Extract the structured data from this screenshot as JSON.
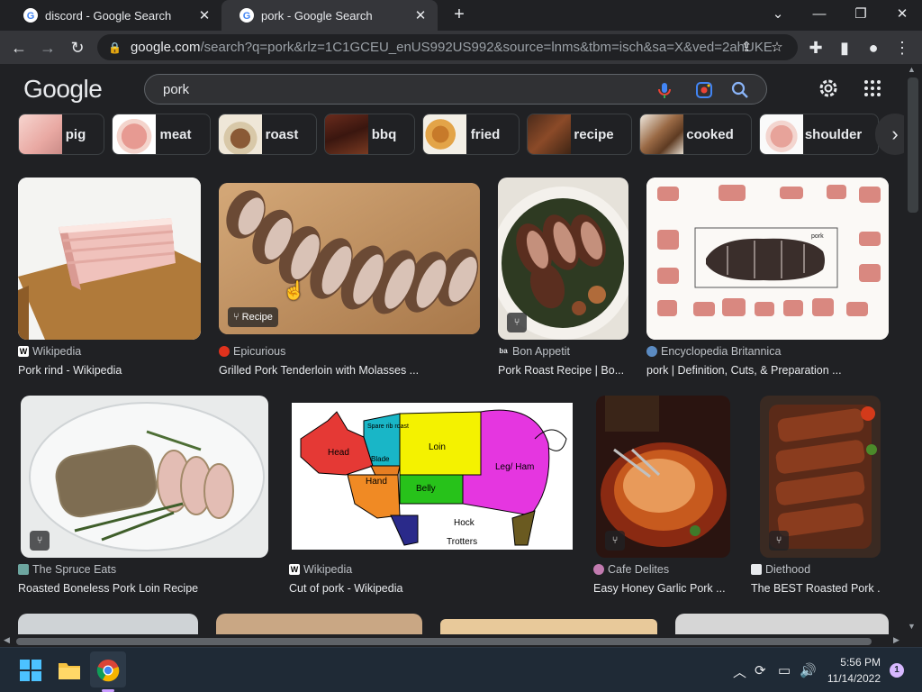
{
  "tabs": [
    {
      "title": "discord - Google Search",
      "active": false
    },
    {
      "title": "pork - Google Search",
      "active": true
    }
  ],
  "toolbar": {
    "url_host": "google.com",
    "url_path": "/search?q=pork&rlz=1C1GCEU_enUS992US992&source=lnms&tbm=isch&sa=X&ved=2ahUKE..."
  },
  "google": {
    "logo": "Google",
    "query": "pork"
  },
  "chips": [
    "pig",
    "meat",
    "roast",
    "bbq",
    "fried",
    "recipe",
    "cooked",
    "shoulder"
  ],
  "results_row1": [
    {
      "source": "Wikipedia",
      "title": "Pork rind - Wikipedia"
    },
    {
      "source": "Epicurious",
      "title": "Grilled Pork Tenderloin with Molasses ...",
      "badge": "Recipe"
    },
    {
      "source": "Bon Appetit",
      "title": "Pork Roast Recipe | Bo..."
    },
    {
      "source": "Encyclopedia Britannica",
      "title": "pork | Definition, Cuts, & Preparation ..."
    }
  ],
  "results_row2": [
    {
      "source": "The Spruce Eats",
      "title": "Roasted Boneless Pork Loin Recipe"
    },
    {
      "source": "Wikipedia",
      "title": "Cut of pork - Wikipedia"
    },
    {
      "source": "Cafe Delites",
      "title": "Easy Honey Garlic Pork ..."
    },
    {
      "source": "Diethood",
      "title": "The BEST Roasted Pork ..."
    }
  ],
  "pig_diagram": {
    "labels": [
      "Head",
      "Spare rib roast",
      "Blade",
      "Loin",
      "Hand",
      "Belly",
      "Leg/ Ham",
      "Hock",
      "Trotters"
    ]
  },
  "britannica_diagram": {
    "labels": [
      "pork"
    ]
  },
  "taskbar": {
    "time": "5:56 PM",
    "date": "11/14/2022",
    "notifications": "1"
  },
  "colors": {
    "background": "#202124",
    "toolbar": "#35363a",
    "accent_blue": "#8ab4f8"
  }
}
